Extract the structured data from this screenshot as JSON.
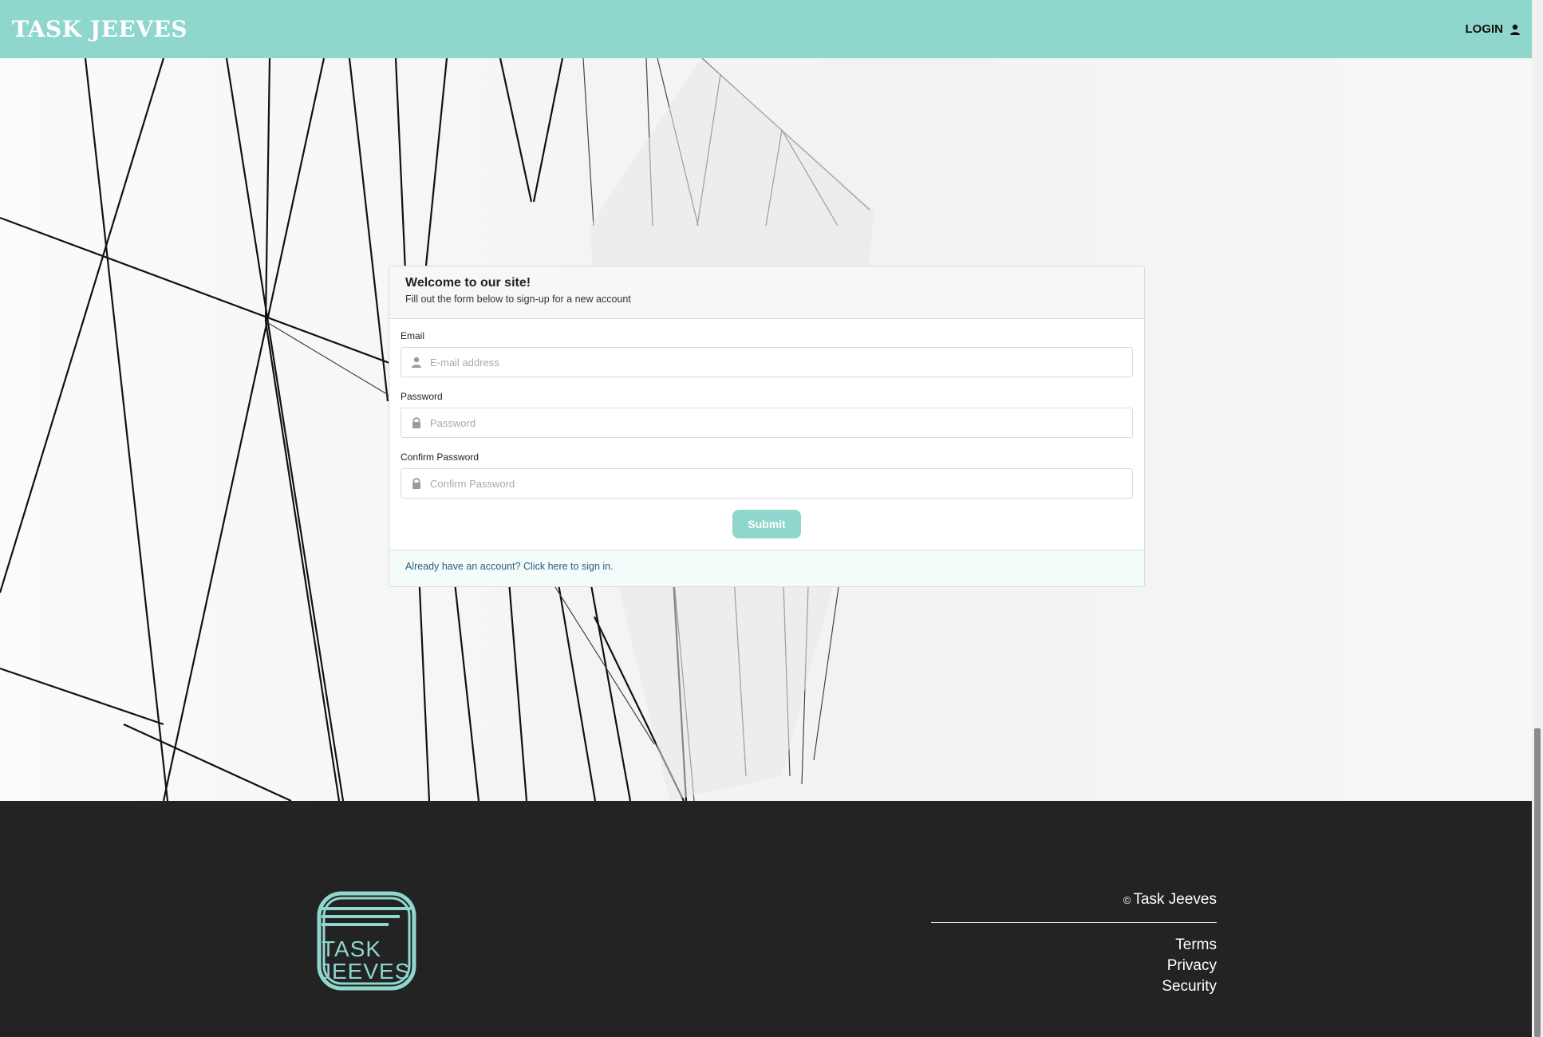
{
  "header": {
    "brand": "TASK JEEVES",
    "login_label": "LOGIN",
    "background_color": "#8fd6cd"
  },
  "signup_card": {
    "title": "Welcome to our site!",
    "subtitle": "Fill out the form below to sign-up for a new account",
    "fields": [
      {
        "label": "Email",
        "placeholder": "E-mail address",
        "value": "",
        "icon": "user-icon"
      },
      {
        "label": "Password",
        "placeholder": "Password",
        "value": "",
        "icon": "lock-icon"
      },
      {
        "label": "Confirm Password",
        "placeholder": "Confirm Password",
        "value": "",
        "icon": "lock-icon"
      }
    ],
    "submit_label": "Submit",
    "signin_prompt": "Already have an account? Click here to sign in."
  },
  "footer": {
    "copyright_symbol": "©",
    "copyright_text": "Task Jeeves",
    "logo_text_line1": "TASK",
    "logo_text_line2": "JEEVES",
    "links": [
      "Terms",
      "Privacy",
      "Security"
    ],
    "background_color": "#232323"
  }
}
